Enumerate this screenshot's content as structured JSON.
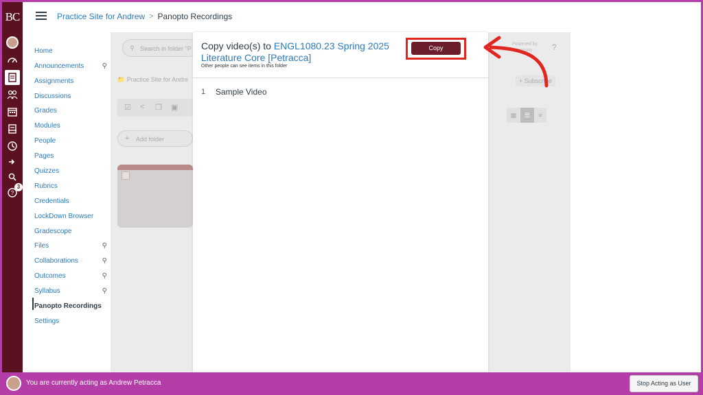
{
  "colors": {
    "accent_maroon": "#5a1220",
    "link_blue": "#2b7abc",
    "annotation_red": "#e0261f",
    "act_bar": "#b53da8"
  },
  "global_nav": {
    "logo": "BC",
    "help_badge": "3"
  },
  "breadcrumb": {
    "course": "Practice Site for Andrew",
    "current": "Panopto Recordings"
  },
  "course_nav": {
    "items": [
      {
        "label": "Home"
      },
      {
        "label": "Announcements"
      },
      {
        "label": "Assignments"
      },
      {
        "label": "Discussions"
      },
      {
        "label": "Grades"
      },
      {
        "label": "Modules"
      },
      {
        "label": "People"
      },
      {
        "label": "Pages"
      },
      {
        "label": "Quizzes"
      },
      {
        "label": "Rubrics"
      },
      {
        "label": "Credentials"
      },
      {
        "label": "LockDown Browser"
      },
      {
        "label": "Gradescope"
      },
      {
        "label": "Files"
      },
      {
        "label": "Collaborations"
      },
      {
        "label": "Outcomes"
      },
      {
        "label": "Syllabus"
      },
      {
        "label": "Panopto Recordings"
      },
      {
        "label": "Settings"
      }
    ]
  },
  "background_page": {
    "search_placeholder": "Search in folder \"P",
    "folder_crumb": "Practice Site for Andre",
    "add_folder": "Add folder",
    "subscribe": "Subscribe",
    "powered_by": "Powered by",
    "powered_by_2": "anopto",
    "help": "?"
  },
  "modal": {
    "title_prefix": "Copy video(s) to",
    "title_folder": "ENGL1080.23 Spring 2025 Literature Core [Petracca]",
    "note": "Other people can see items in this folder",
    "copy_label": "Copy",
    "rows": [
      {
        "num": "1",
        "title": "Sample Video"
      }
    ]
  },
  "acting_bar": {
    "text": "You are currently acting as Andrew Petracca",
    "stop_label": "Stop Acting as User"
  }
}
